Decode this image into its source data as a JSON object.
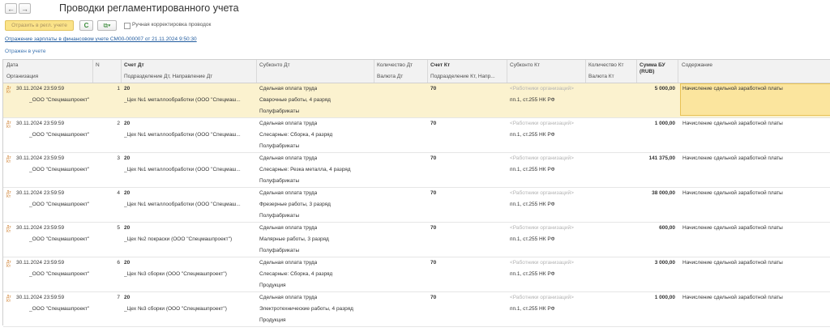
{
  "window": {
    "title": "Проводки регламентированного учета"
  },
  "nav": {
    "back": "←",
    "forward": "→"
  },
  "toolbar": {
    "post_label": "Отразить в регл. учете",
    "refresh_icon": "refresh-icon",
    "refresh_glyph": "C",
    "copy_icon": "copy-icon",
    "copy_glyph": "⧉▾",
    "manual_label": "Ручная корректировка проводок"
  },
  "document_link": "Отражение зарплаты в финансовом учете СМ00-000007 от 21.11.2024 9:50:30",
  "status": "Отражен в учете",
  "headers": {
    "date": "Дата",
    "n": "N",
    "acct_dt": "Счет Дт",
    "subkonto_dt": "Субконто Дт",
    "qty_dt": "Количество Дт",
    "acct_kt": "Счет Кт",
    "subkonto_kt": "Субконто Кт",
    "qty_kt": "Количество Кт",
    "sum": "Сумма БУ (RUB)",
    "content": "Содержание",
    "org": "Организация",
    "dept_dt": "Подразделение Дт, Направление Дт",
    "cur_dt": "Валюта Дт",
    "dept_kt": "Подразделение Кт, Напр...",
    "cur_kt": "Валюта Кт"
  },
  "rows": [
    {
      "date": "30.11.2024 23:59:59",
      "n": "1",
      "acct_dt": "20",
      "org": "_ООО \"Спецмашпроект\"",
      "dept_dt": "_Цех №1 металлообработки (ООО \"Спецмаш...",
      "sub_dt1": "Сдельная оплата труда",
      "sub_dt2": "Сварочные работы, 4 разряд",
      "sub_dt3": "Полуфабрикаты",
      "acct_kt": "70",
      "sub_kt1": "<Работники организаций>",
      "sub_kt2": "пп.1, ст.255 НК РФ",
      "sum": "5 000,00",
      "content": "Начисление сдельной заработной платы"
    },
    {
      "date": "30.11.2024 23:59:59",
      "n": "2",
      "acct_dt": "20",
      "org": "_ООО \"Спецмашпроект\"",
      "dept_dt": "_Цех №1 металлообработки (ООО \"Спецмаш...",
      "sub_dt1": "Сдельная оплата труда",
      "sub_dt2": "Слесарные: Сборка, 4 разряд",
      "sub_dt3": "Полуфабрикаты",
      "acct_kt": "70",
      "sub_kt1": "<Работники организаций>",
      "sub_kt2": "пп.1, ст.255 НК РФ",
      "sum": "1 000,00",
      "content": "Начисление сдельной заработной платы"
    },
    {
      "date": "30.11.2024 23:59:59",
      "n": "3",
      "acct_dt": "20",
      "org": "_ООО \"Спецмашпроект\"",
      "dept_dt": "_Цех №1 металлообработки (ООО \"Спецмаш...",
      "sub_dt1": "Сдельная оплата труда",
      "sub_dt2": "Слесарные: Резка металла, 4 разряд",
      "sub_dt3": "Полуфабрикаты",
      "acct_kt": "70",
      "sub_kt1": "<Работники организаций>",
      "sub_kt2": "пп.1, ст.255 НК РФ",
      "sum": "141 375,00",
      "content": "Начисление сдельной заработной платы"
    },
    {
      "date": "30.11.2024 23:59:59",
      "n": "4",
      "acct_dt": "20",
      "org": "_ООО \"Спецмашпроект\"",
      "dept_dt": "_Цех №1 металлообработки (ООО \"Спецмаш...",
      "sub_dt1": "Сдельная оплата труда",
      "sub_dt2": "Фрезерные работы, 3 разряд",
      "sub_dt3": "Полуфабрикаты",
      "acct_kt": "70",
      "sub_kt1": "<Работники организаций>",
      "sub_kt2": "пп.1, ст.255 НК РФ",
      "sum": "38 000,00",
      "content": "Начисление сдельной заработной платы"
    },
    {
      "date": "30.11.2024 23:59:59",
      "n": "5",
      "acct_dt": "20",
      "org": "_ООО \"Спецмашпроект\"",
      "dept_dt": "_Цех №2 покраски (ООО \"Спецмашпроект\")",
      "sub_dt1": "Сдельная оплата труда",
      "sub_dt2": "Малярные работы, 3 разряд",
      "sub_dt3": "Полуфабрикаты",
      "acct_kt": "70",
      "sub_kt1": "<Работники организаций>",
      "sub_kt2": "пп.1, ст.255 НК РФ",
      "sum": "600,00",
      "content": "Начисление сдельной заработной платы"
    },
    {
      "date": "30.11.2024 23:59:59",
      "n": "6",
      "acct_dt": "20",
      "org": "_ООО \"Спецмашпроект\"",
      "dept_dt": "_Цех №3 сборки (ООО \"Спецмашпроект\")",
      "sub_dt1": "Сдельная оплата труда",
      "sub_dt2": "Слесарные: Сборка, 4 разряд",
      "sub_dt3": "Продукция",
      "acct_kt": "70",
      "sub_kt1": "<Работники организаций>",
      "sub_kt2": "пп.1, ст.255 НК РФ",
      "sum": "3 000,00",
      "content": "Начисление сдельной заработной платы"
    },
    {
      "date": "30.11.2024 23:59:59",
      "n": "7",
      "acct_dt": "20",
      "org": "_ООО \"Спецмашпроект\"",
      "dept_dt": "_Цех №3 сборки (ООО \"Спецмашпроект\")",
      "sub_dt1": "Сдельная оплата труда",
      "sub_dt2": "Электротехнические работы, 4 разряд",
      "sub_dt3": "Продукция",
      "acct_kt": "70",
      "sub_kt1": "<Работники организаций>",
      "sub_kt2": "пп.1, ст.255 НК РФ",
      "sum": "1 000,00",
      "content": "Начисление сдельной заработной платы"
    }
  ],
  "row_icon": "ledger-entry-icon",
  "row_icon_glyph": "ДТ\nКТ",
  "colors": {
    "accent_yellow": "#fbe389",
    "selected_row": "#fbf2cf",
    "link": "#1f5a9e"
  }
}
